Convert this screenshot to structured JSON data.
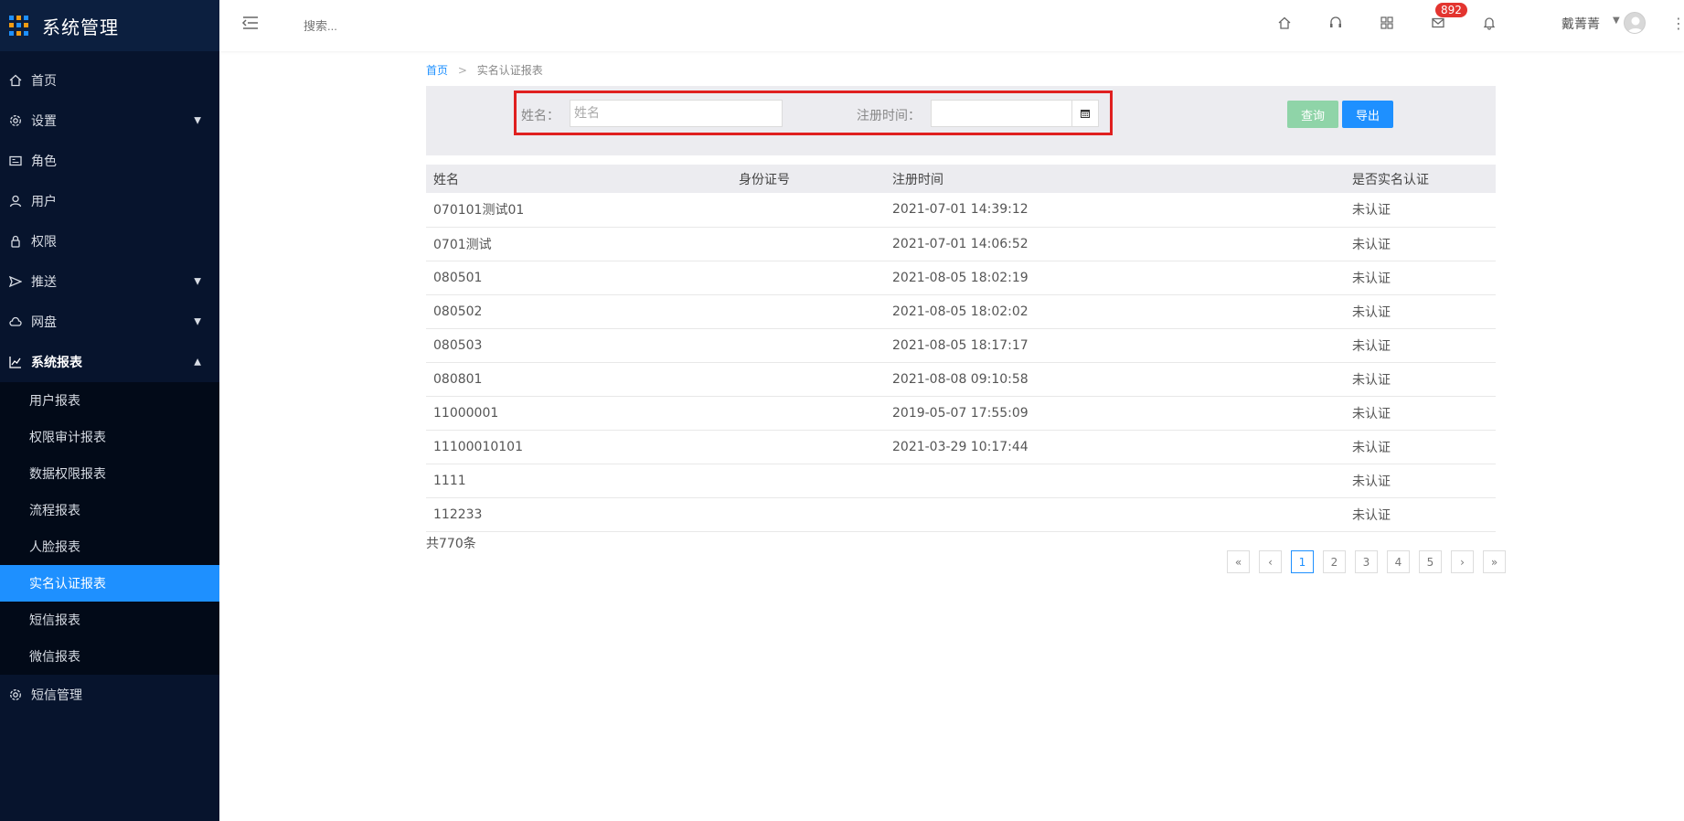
{
  "app": {
    "title": "系统管理"
  },
  "sidebar": {
    "items": [
      {
        "label": "首页",
        "icon": "home-icon"
      },
      {
        "label": "设置",
        "icon": "gear-icon",
        "expandable": true
      },
      {
        "label": "角色",
        "icon": "id-card-icon"
      },
      {
        "label": "用户",
        "icon": "user-icon"
      },
      {
        "label": "权限",
        "icon": "lock-icon"
      },
      {
        "label": "推送",
        "icon": "send-icon",
        "expandable": true
      },
      {
        "label": "网盘",
        "icon": "cloud-icon",
        "expandable": true
      },
      {
        "label": "系统报表",
        "icon": "chart-line-icon",
        "expanded": true
      },
      {
        "label": "短信管理",
        "icon": "gear-icon"
      }
    ],
    "report_subitems": [
      "用户报表",
      "权限审计报表",
      "数据权限报表",
      "流程报表",
      "人脸报表",
      "实名认证报表",
      "短信报表",
      "微信报表"
    ],
    "active_subitem": "实名认证报表"
  },
  "topbar": {
    "search_placeholder": "搜索...",
    "mail_badge": "892",
    "user_name": "戴菁菁"
  },
  "breadcrumb": {
    "home": "首页",
    "separator": ">",
    "current": "实名认证报表"
  },
  "filters": {
    "name_label": "姓名：",
    "name_placeholder": "姓名",
    "reg_time_label": "注册时间：",
    "query_button": "查询",
    "export_button": "导出"
  },
  "table": {
    "headers": [
      "姓名",
      "身份证号",
      "注册时间",
      "是否实名认证"
    ],
    "rows": [
      [
        "070101测试01",
        "",
        "2021-07-01 14:39:12",
        "未认证"
      ],
      [
        "0701测试",
        "",
        "2021-07-01 14:06:52",
        "未认证"
      ],
      [
        "080501",
        "",
        "2021-08-05 18:02:19",
        "未认证"
      ],
      [
        "080502",
        "",
        "2021-08-05 18:02:02",
        "未认证"
      ],
      [
        "080503",
        "",
        "2021-08-05 18:17:17",
        "未认证"
      ],
      [
        "080801",
        "",
        "2021-08-08 09:10:58",
        "未认证"
      ],
      [
        "11000001",
        "",
        "2019-05-07 17:55:09",
        "未认证"
      ],
      [
        "11100010101",
        "",
        "2021-03-29 10:17:44",
        "未认证"
      ],
      [
        "1111",
        "",
        "",
        "未认证"
      ],
      [
        "112233",
        "",
        "",
        "未认证"
      ]
    ]
  },
  "pagination": {
    "total": "共770条",
    "first": "«",
    "prev": "‹",
    "next": "›",
    "last": "»",
    "pages": [
      "1",
      "2",
      "3",
      "4",
      "5"
    ],
    "current": "1"
  },
  "colors": {
    "accent": "#1e90ff",
    "sidebar_bg": "#07142d",
    "highlight_border": "#e02020",
    "query_btn": "#8fd4a8"
  }
}
